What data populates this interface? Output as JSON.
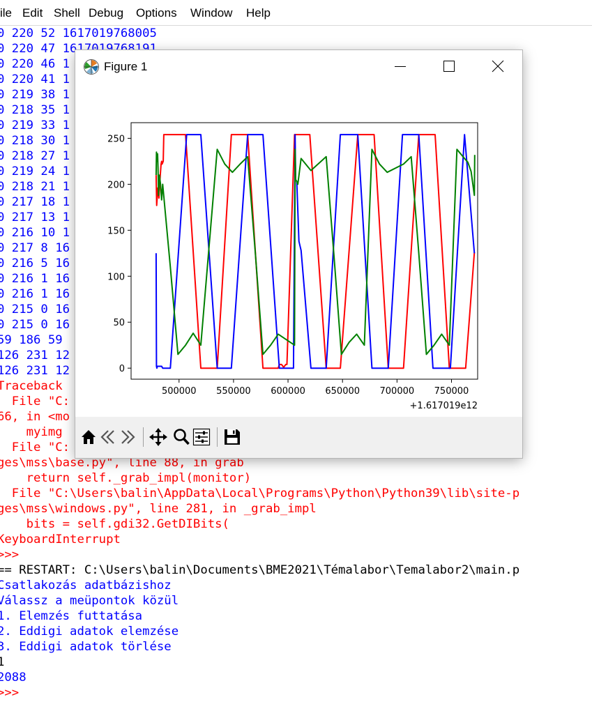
{
  "menubar": {
    "items": [
      "ile",
      "Edit",
      "Shell",
      "Debug",
      "Options",
      "Window",
      "Help"
    ]
  },
  "shell": {
    "lines": [
      {
        "text": "0 220 52 1617019768005",
        "color": "blue"
      },
      {
        "text": "0 220 47 1617019768191",
        "color": "blue"
      },
      {
        "text": "0 220 46 1",
        "color": "blue"
      },
      {
        "text": "0 220 41 1",
        "color": "blue"
      },
      {
        "text": "0 219 38 1",
        "color": "blue"
      },
      {
        "text": "0 218 35 1",
        "color": "blue"
      },
      {
        "text": "0 219 33 1",
        "color": "blue"
      },
      {
        "text": "0 218 30 1",
        "color": "blue"
      },
      {
        "text": "0 218 27 1",
        "color": "blue"
      },
      {
        "text": "0 219 24 1",
        "color": "blue"
      },
      {
        "text": "0 218 21 1",
        "color": "blue"
      },
      {
        "text": "0 217 18 1",
        "color": "blue"
      },
      {
        "text": "0 217 13 1",
        "color": "blue"
      },
      {
        "text": "0 216 10 1",
        "color": "blue"
      },
      {
        "text": "0 217 8 16",
        "color": "blue"
      },
      {
        "text": "0 216 5 16",
        "color": "blue"
      },
      {
        "text": "0 216 1 16",
        "color": "blue"
      },
      {
        "text": "0 216 1 16",
        "color": "blue"
      },
      {
        "text": "0 215 0 16",
        "color": "blue"
      },
      {
        "text": "0 215 0 16",
        "color": "blue"
      },
      {
        "text": "59 186 59 ",
        "color": "blue"
      },
      {
        "text": "126 231 12",
        "color": "blue"
      },
      {
        "text": "126 231 12",
        "color": "blue"
      },
      {
        "text": "Traceback                                         ",
        "color": "red"
      },
      {
        "text": "  File \"C:                                        ain.py\",",
        "color": "red"
      },
      {
        "text": "66, in <mo",
        "color": "red"
      },
      {
        "text": "    myimg ",
        "color": "red"
      },
      {
        "text": "  File \"C:                                        ib\\site-p",
        "color": "red"
      },
      {
        "text": "ges\\mss\\base.py\", line 88, in grab",
        "color": "red"
      },
      {
        "text": "    return self._grab_impl(monitor)",
        "color": "red"
      },
      {
        "text": "  File \"C:\\Users\\balin\\AppData\\Local\\Programs\\Python\\Python39\\lib\\site-p",
        "color": "red"
      },
      {
        "text": "ges\\mss\\windows.py\", line 281, in _grab_impl",
        "color": "red"
      },
      {
        "text": "    bits = self.gdi32.GetDIBits(",
        "color": "red"
      },
      {
        "text": "KeyboardInterrupt",
        "color": "red"
      },
      {
        "text": ">>>",
        "color": "red"
      },
      {
        "text": "== RESTART: C:\\Users\\balin\\Documents\\BME2021\\Témalabor\\Temalabor2\\main.p",
        "color": "black"
      },
      {
        "text": "Csatlakozás adatbázishoz",
        "color": "blue"
      },
      {
        "text": "Válassz a meüpontok közül",
        "color": "blue"
      },
      {
        "text": "1. Elemzés futtatása",
        "color": "blue"
      },
      {
        "text": "2. Eddigi adatok elemzése",
        "color": "blue"
      },
      {
        "text": "3. Eddigi adatok törlése",
        "color": "blue"
      },
      {
        "text": "1",
        "color": "black"
      },
      {
        "text": "2088",
        "color": "blue"
      },
      {
        "text": ">>>",
        "color": "red"
      }
    ]
  },
  "figure": {
    "title": "Figure 1",
    "icons": {
      "app": "matplotlib-icon",
      "minimize": "minimize-icon",
      "maximize": "maximize-icon",
      "close": "close-icon"
    },
    "toolbar": [
      {
        "name": "home-icon"
      },
      {
        "name": "back-arrow-icon"
      },
      {
        "name": "forward-arrow-icon"
      },
      {
        "name": "pan-icon"
      },
      {
        "name": "zoom-icon"
      },
      {
        "name": "subplots-config-icon"
      },
      {
        "name": "save-icon"
      }
    ]
  },
  "chart_data": {
    "type": "line",
    "title": "",
    "xlabel": "",
    "ylabel": "",
    "x_offset_label": "+1.617019e12",
    "xlim": [
      456000,
      774000
    ],
    "ylim": [
      -12,
      267
    ],
    "xticks": [
      500000,
      550000,
      600000,
      650000,
      700000,
      750000
    ],
    "yticks": [
      0,
      50,
      100,
      150,
      200,
      250
    ],
    "grid": false,
    "legend": "none",
    "series": [
      {
        "color": "#ff0000",
        "x": [
          479000,
          479500,
          480500,
          481500,
          482500,
          483500,
          484000,
          484500,
          485500,
          486000,
          488000,
          492000,
          506000,
          520000,
          535000,
          548000,
          563000,
          577000,
          591000,
          592000,
          594000,
          596000,
          598000,
          599000,
          606000,
          620000,
          635000,
          648000,
          664000,
          677000,
          679000,
          692000,
          706000,
          720000,
          735000,
          748000,
          763000,
          771000
        ],
        "y": [
          210,
          177,
          196,
          185,
          205,
          222,
          225,
          222,
          225,
          254,
          254,
          254,
          254,
          0,
          0,
          254,
          254,
          0,
          0,
          4,
          4,
          1,
          4,
          4,
          254,
          254,
          0,
          0,
          254,
          254,
          254,
          0,
          0,
          254,
          254,
          0,
          0,
          126
        ]
      },
      {
        "color": "#0000ff",
        "x": [
          479000,
          479300,
          479700,
          480000,
          481000,
          484000,
          485000,
          492000,
          507000,
          520000,
          535000,
          548000,
          563000,
          577000,
          592000,
          605000,
          606500,
          607000,
          608000,
          610000,
          612000,
          614000,
          621000,
          635000,
          648000,
          664000,
          677000,
          692000,
          705000,
          720000,
          733000,
          749000,
          762000,
          771000
        ],
        "y": [
          125,
          2,
          0,
          2,
          2,
          2,
          0,
          0,
          254,
          254,
          0,
          0,
          254,
          254,
          0,
          0,
          254,
          205,
          203,
          138,
          128,
          100,
          0,
          0,
          254,
          254,
          0,
          0,
          254,
          254,
          0,
          0,
          254,
          125
        ]
      },
      {
        "color": "#008000",
        "x": [
          479000,
          479300,
          479700,
          480300,
          480700,
          481200,
          482000,
          483000,
          484000,
          485000,
          492000,
          499000,
          506000,
          513000,
          520000,
          535000,
          542000,
          549000,
          556000,
          563000,
          570000,
          577000,
          584000,
          591000,
          606000,
          606500,
          607000,
          608000,
          609000,
          612000,
          621000,
          635000,
          642000,
          649000,
          656000,
          663000,
          670000,
          677000,
          684000,
          691000,
          706000,
          713000,
          720000,
          727000,
          734000,
          741000,
          748000,
          755000,
          762000,
          765000,
          768000,
          771000,
          771300
        ],
        "y": [
          210,
          235,
          225,
          233,
          218,
          188,
          210,
          200,
          183,
          200,
          110,
          15,
          25,
          38,
          25,
          238,
          222,
          213,
          222,
          230,
          125,
          15,
          25,
          37,
          25,
          238,
          205,
          203,
          200,
          228,
          215,
          230,
          125,
          15,
          28,
          37,
          25,
          238,
          222,
          213,
          222,
          230,
          125,
          15,
          25,
          37,
          25,
          238,
          228,
          224,
          214,
          188,
          232
        ]
      }
    ]
  }
}
